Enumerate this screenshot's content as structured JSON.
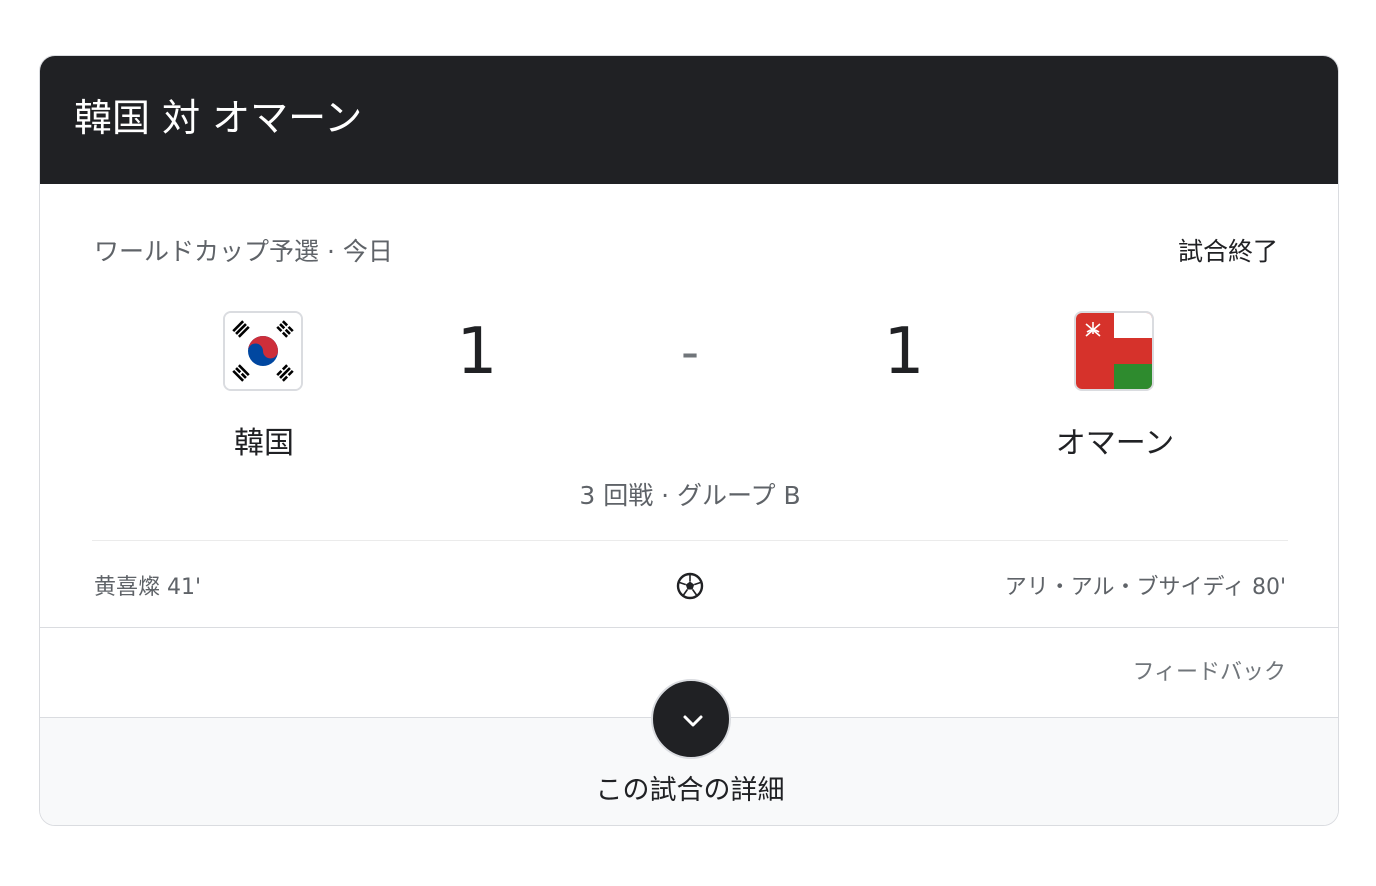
{
  "header": {
    "title": "韓国 対 オマーン"
  },
  "match": {
    "competition": "ワールドカップ予選 · 今日",
    "status": "試合終了",
    "round": "3 回戦 · グループ B",
    "score_separator": "-",
    "home": {
      "name": "韓国",
      "score": "1",
      "flag_icon": "south-korea-flag-icon"
    },
    "away": {
      "name": "オマーン",
      "score": "1",
      "flag_icon": "oman-flag-icon"
    }
  },
  "goals": {
    "home_scorer": "黄喜燦 41'",
    "away_scorer": "アリ・アル・ブサイディ 80'",
    "icon": "soccer-ball-icon"
  },
  "feedback_label": "フィードバック",
  "details": {
    "label": "この試合の詳細",
    "icon": "chevron-down-icon"
  },
  "colors": {
    "header_bg": "#202124",
    "korea_red": "#cd2e3a",
    "korea_blue": "#0047a0",
    "oman_red": "#db161b",
    "oman_green": "#008000"
  }
}
